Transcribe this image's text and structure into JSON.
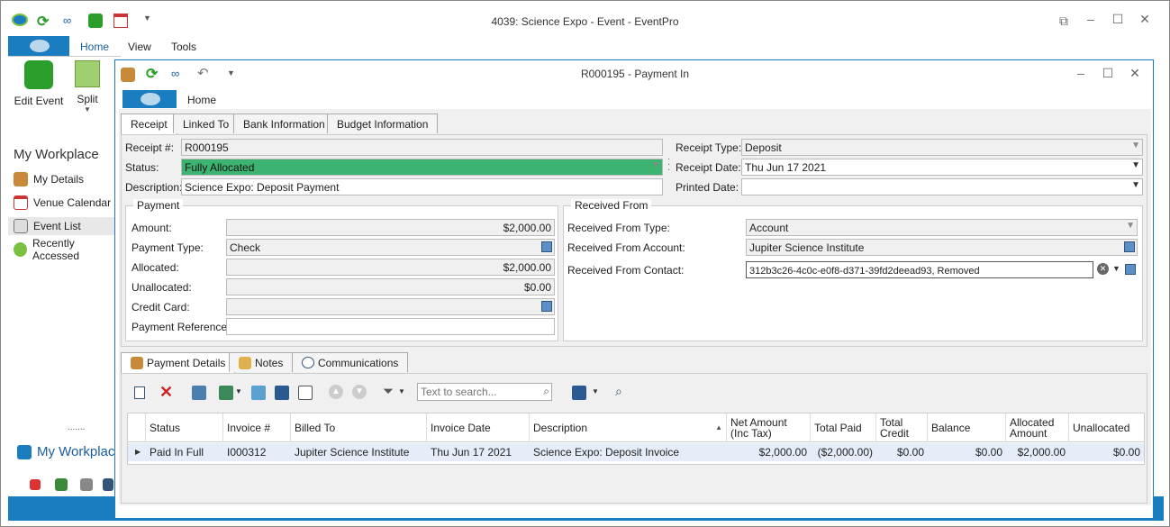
{
  "outer": {
    "title": "4039: Science Expo - Event - EventPro",
    "tabs": [
      "Home",
      "View",
      "Tools"
    ],
    "ribbon": {
      "edit_event": "Edit Event",
      "split": "Split"
    },
    "workplace_title": "My Workplace",
    "workplace_items": [
      "My Details",
      "Venue Calendar",
      "Event List",
      "Recently Accessed"
    ],
    "workplace_footer": "My Workplace",
    "grip": "......."
  },
  "inner": {
    "title": "R000195 - Payment In",
    "home_tab": "Home",
    "tabs": [
      "Receipt",
      "Linked To",
      "Bank Information",
      "Budget Information"
    ],
    "receipt": {
      "receipt_no_label": "Receipt #:",
      "receipt_no": "R000195",
      "status_label": "Status:",
      "status": "Fully Allocated",
      "description_label": "Description:",
      "description": "Science Expo: Deposit Payment",
      "receipt_type_label": "Receipt Type:",
      "receipt_type": "Deposit",
      "receipt_date_label": "Receipt Date:",
      "receipt_date": "Thu Jun 17 2021",
      "printed_date_label": "Printed Date:",
      "printed_date": ""
    },
    "payment": {
      "title": "Payment",
      "amount_label": "Amount:",
      "amount": "$2,000.00",
      "type_label": "Payment Type:",
      "type": "Check",
      "allocated_label": "Allocated:",
      "allocated": "$2,000.00",
      "unallocated_label": "Unallocated:",
      "unallocated": "$0.00",
      "credit_card_label": "Credit Card:",
      "credit_card": "",
      "reference_label": "Payment Reference:",
      "reference": ""
    },
    "received_from": {
      "title": "Received From",
      "type_label": "Received From Type:",
      "type": "Account",
      "account_label": "Received From Account:",
      "account": "Jupiter Science Institute",
      "contact_label": "Received From Contact:",
      "contact": "312b3c26-4c0c-e0f8-d371-39fd2deead93, Removed"
    },
    "bottom_tabs": [
      "Payment Details",
      "Notes",
      "Communications"
    ],
    "search_placeholder": "Text to search...",
    "grid": {
      "headers": [
        "Status",
        "Invoice #",
        "Billed To",
        "Invoice Date",
        "Description",
        "Net Amount (Inc Tax)",
        "Total Paid",
        "Total Credit",
        "Balance",
        "Allocated Amount",
        "Unallocated"
      ],
      "rows": [
        [
          "Paid In Full",
          "I000312",
          "Jupiter Science Institute",
          "Thu Jun 17 2021",
          "Science Expo: Deposit Invoice",
          "$2,000.00",
          "($2,000.00)",
          "$0.00",
          "$0.00",
          "$2,000.00",
          "$0.00"
        ]
      ]
    }
  },
  "colors": {
    "accent": "#1a7dc0",
    "status_green": "#3cb371"
  }
}
